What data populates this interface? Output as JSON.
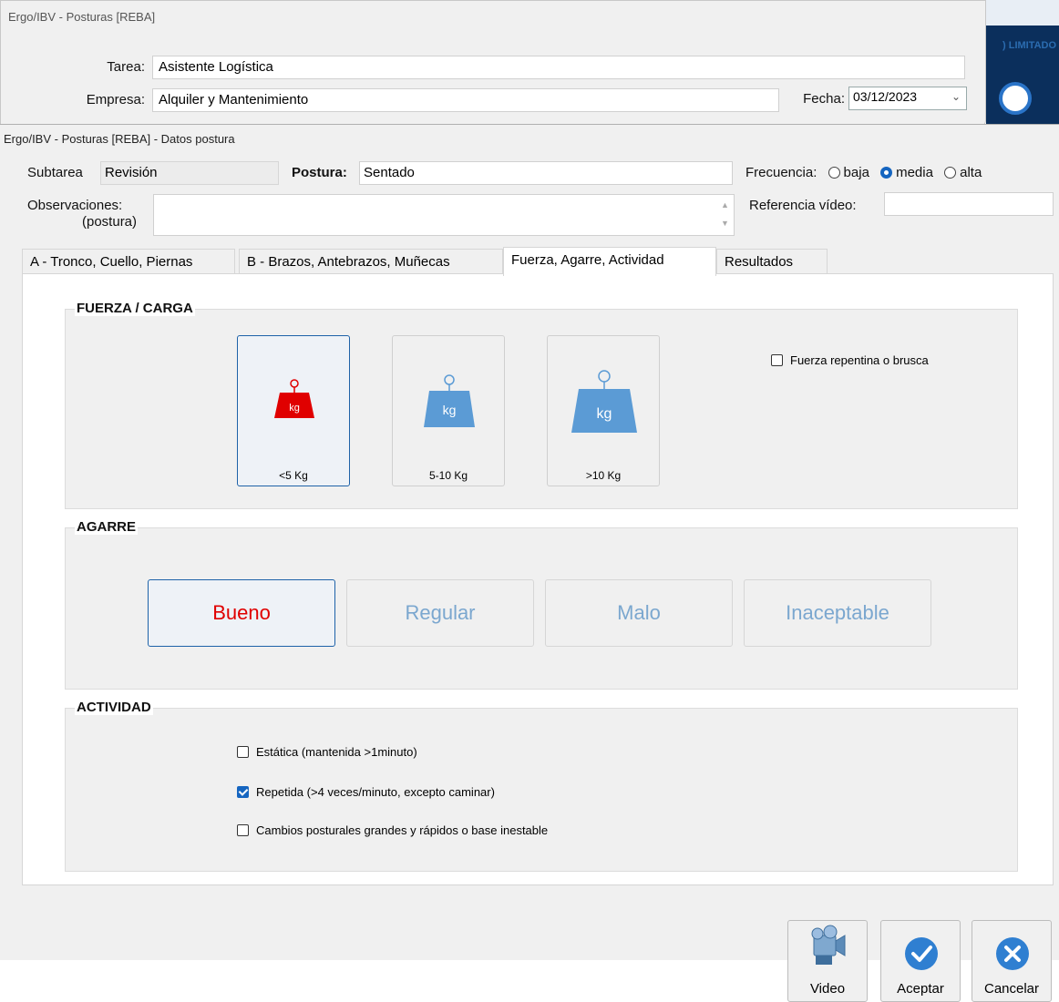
{
  "parent_window": {
    "title": "Ergo/IBV - Posturas [REBA]",
    "tarea_label": "Tarea:",
    "tarea_value": "Asistente Logística",
    "empresa_label": "Empresa:",
    "empresa_value": "Alquiler y Mantenimiento",
    "fecha_label": "Fecha:",
    "fecha_value": "03/12/2023",
    "side_text": ") LIMITADO A"
  },
  "dialog": {
    "title": "Ergo/IBV - Posturas [REBA] - Datos postura",
    "subtarea_label": "Subtarea",
    "subtarea_value": "Revisión",
    "postura_label": "Postura:",
    "postura_value": "Sentado",
    "frecuencia_label": "Frecuencia:",
    "frecuencia_options": [
      "baja",
      "media",
      "alta"
    ],
    "frecuencia_selected": "media",
    "observaciones_label": "Observaciones:",
    "observaciones_sub": "(postura)",
    "observaciones_value": "",
    "referencia_label": "Referencia vídeo:",
    "referencia_value": ""
  },
  "tabs": [
    {
      "label": "A - Tronco, Cuello, Piernas"
    },
    {
      "label": "B - Brazos, Antebrazos, Muñecas"
    },
    {
      "label": "Fuerza, Agarre, Actividad"
    },
    {
      "label": "Resultados"
    }
  ],
  "active_tab": "Fuerza, Agarre, Actividad",
  "fuerza": {
    "title": "FUERZA / CARGA",
    "options": [
      {
        "label": "<5 Kg",
        "icon_text": "kg",
        "selected": true
      },
      {
        "label": "5-10 Kg",
        "icon_text": "kg",
        "selected": false
      },
      {
        "label": ">10 Kg",
        "icon_text": "kg",
        "selected": false
      }
    ],
    "repentina_label": "Fuerza repentina o brusca",
    "repentina_checked": false
  },
  "agarre": {
    "title": "AGARRE",
    "options": [
      {
        "label": "Bueno",
        "selected": true
      },
      {
        "label": "Regular",
        "selected": false
      },
      {
        "label": "Malo",
        "selected": false
      },
      {
        "label": "Inaceptable",
        "selected": false
      }
    ]
  },
  "actividad": {
    "title": "ACTIVIDAD",
    "items": [
      {
        "label": "Estática (mantenida >1minuto)",
        "checked": false
      },
      {
        "label": "Repetida (>4 veces/minuto, excepto caminar)",
        "checked": true
      },
      {
        "label": "Cambios posturales grandes y rápidos o base inestable",
        "checked": false
      }
    ]
  },
  "buttons": {
    "video": "Video",
    "aceptar": "Aceptar",
    "cancelar": "Cancelar"
  },
  "colors": {
    "selected_red": "#e00000",
    "weight_blue": "#5b9bd5",
    "accent_blue": "#1565c0",
    "selected_border": "#1e62a8"
  }
}
